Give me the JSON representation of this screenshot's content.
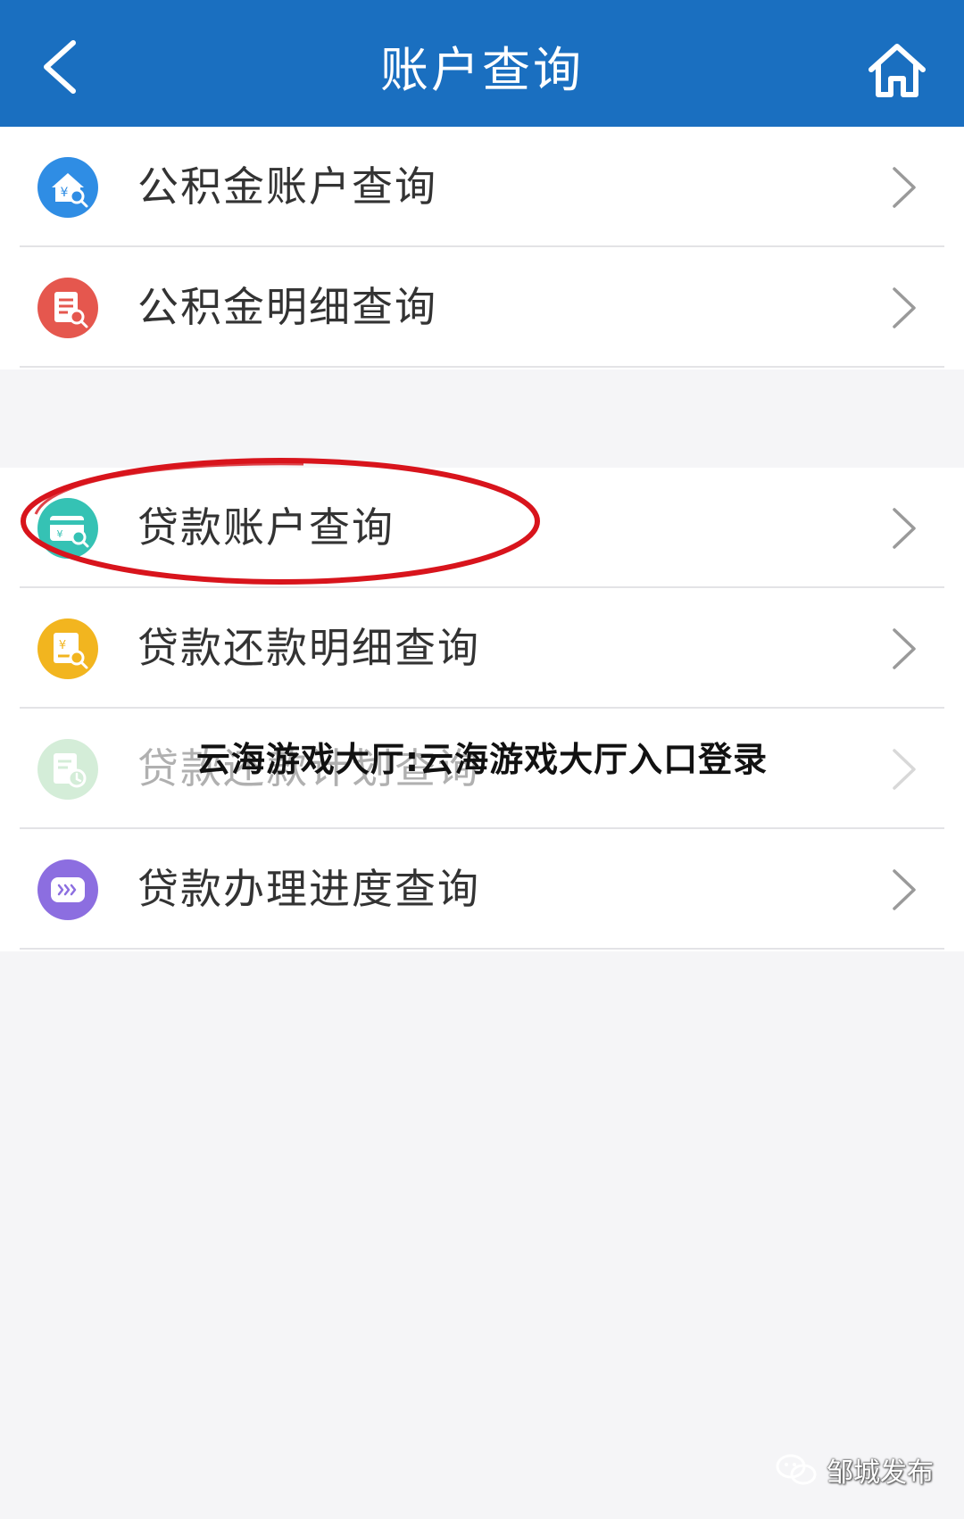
{
  "header": {
    "title": "账户查询"
  },
  "menu": {
    "group1": [
      {
        "label": "公积金账户查询",
        "icon": "house-search-icon",
        "color": "#2f8de4"
      },
      {
        "label": "公积金明细查询",
        "icon": "document-search-icon",
        "color": "#e5574e"
      }
    ],
    "group2": [
      {
        "label": "贷款账户查询",
        "icon": "card-search-icon",
        "color": "#35c2b4"
      },
      {
        "label": "贷款还款明细查询",
        "icon": "receipt-search-icon",
        "color": "#f2b51f"
      },
      {
        "label": "贷款还款计划查询",
        "icon": "document-clock-icon",
        "color": "#8fd19b"
      },
      {
        "label": "贷款办理进度查询",
        "icon": "progress-icon",
        "color": "#8c6ee0"
      }
    ]
  },
  "overlay": {
    "caption": "云海游戏大厅:云海游戏大厅入口登录"
  },
  "watermark": {
    "text": "邹城发布"
  },
  "colors": {
    "header_bg": "#1a6fc0",
    "annotation": "#d8141c"
  }
}
